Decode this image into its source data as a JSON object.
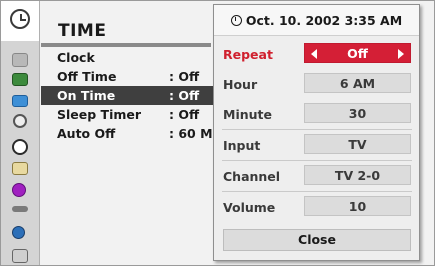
{
  "header": {
    "title": "TIME"
  },
  "sidebar": {
    "icons": [
      "clock-large-icon",
      "picture-icon",
      "tv-icon",
      "screen-icon",
      "audio-icon",
      "time-icon",
      "option-icon",
      "info-icon",
      "lock-icon",
      "setup-icon",
      "channel-icon"
    ]
  },
  "menu": {
    "items": [
      {
        "label": "Clock",
        "value": ""
      },
      {
        "label": "Off Time",
        "value": ": Off"
      },
      {
        "label": "On Time",
        "value": ": Off"
      },
      {
        "label": "Sleep Timer",
        "value": ": Off"
      },
      {
        "label": "Auto Off",
        "value": ": 60 M"
      }
    ]
  },
  "popup": {
    "datetime": "Oct. 10. 2002 3:35 AM",
    "rows": [
      {
        "label": "Repeat",
        "value": "Off"
      },
      {
        "label": "Hour",
        "value": "6 AM"
      },
      {
        "label": "Minute",
        "value": "30"
      },
      {
        "label": "Input",
        "value": "TV"
      },
      {
        "label": "Channel",
        "value": "TV 2-0"
      },
      {
        "label": "Volume",
        "value": "10"
      }
    ],
    "close_label": "Close"
  },
  "colors": {
    "accent": "#d41f36",
    "highlight": "#3f3f3f"
  }
}
